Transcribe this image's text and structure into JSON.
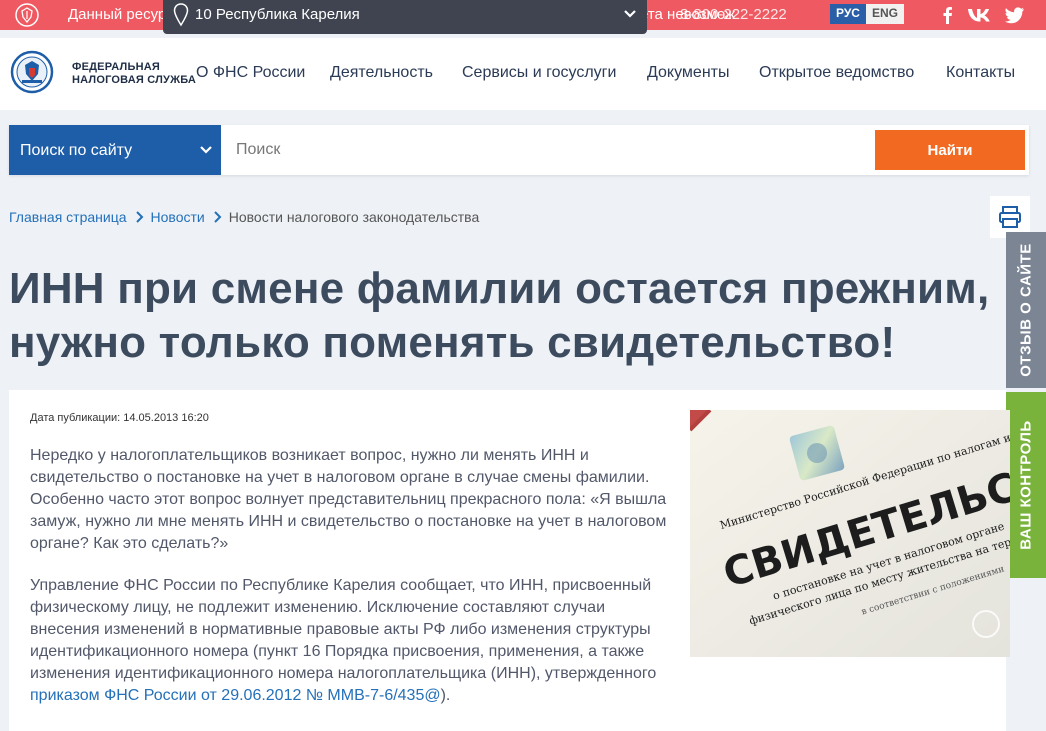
{
  "topbar": {
    "notice_left": "Данный ресур",
    "notice_right": "ета невозмож",
    "phone": "8-800-222-2222",
    "region_selected": "10 Республика Карелия",
    "lang_ru": "РУС",
    "lang_en": "ENG"
  },
  "header": {
    "logo_line1": "ФЕДЕРАЛЬНАЯ",
    "logo_line2": "НАЛОГОВАЯ СЛУЖБА",
    "nav": [
      "О ФНС России",
      "Деятельность",
      "Сервисы и госуслуги",
      "Документы",
      "Открытое ведомство",
      "Контакты"
    ]
  },
  "search": {
    "scope": "Поиск по сайту",
    "placeholder": "Поиск",
    "button": "Найти"
  },
  "breadcrumb": [
    "Главная страница",
    "Новости",
    "Новости налогового законодательства"
  ],
  "article": {
    "title_line1": "ИНН при смене фамилии остается прежним,",
    "title_line2": "нужно только поменять свидетельство!",
    "pub_date": "Дата публикации: 14.05.2013 16:20",
    "p1": "Нередко у налогоплательщиков возникает вопрос, нужно ли менять ИНН и свидетельство о постановке на учет в налоговом органе в случае смены фамилии. Особенно часто этот вопрос волнует представительниц прекрасного пола: «Я вышла замуж, нужно ли мне менять ИНН и свидетельство о постановке на учет в налоговом органе? Как это сделать?»",
    "p2": "Управление ФНС России по Республике Карелия сообщает, что ИНН, присвоенный физическому лицу, не подлежит изменению. Исключение составляют случаи внесения изменений в нормативные правовые акты РФ либо изменения структуры идентификационного номера (пункт 16 Порядка присвоения, применения, а также изменения идентификационного номера налогоплательщика (ИНН), утвержденного ",
    "p2_link": "приказом ФНС России от 29.06.2012 № ММВ-7-6/435@",
    "p2_end": ").",
    "image": {
      "line_top": "Министерство Российской Федерации по налогам и сборам",
      "word": "СВИДЕТЕЛЬСТВО",
      "line_a": "о постановке на учет в налоговом органе",
      "line_b": "физического лица по месту жительства на территории Российской",
      "line_c": "в соответствии с положениями"
    }
  },
  "side": {
    "feedback": "ОТЗЫВ О САЙТЕ",
    "control": "ВАШ КОНТРОЛЬ"
  },
  "colors": {
    "topbar": "#ef5a62",
    "search_scope": "#1e5ea8",
    "search_button": "#f26a21",
    "link": "#2470b9",
    "feedback_tab": "#7b8594",
    "control_tab": "#79b33c"
  }
}
